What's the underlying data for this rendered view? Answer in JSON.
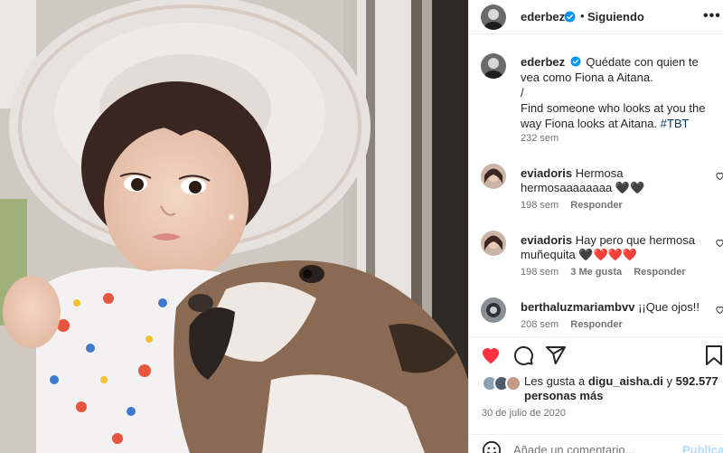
{
  "post": {
    "author": "ederbez",
    "follow_separator": "•",
    "follow_status": "Siguiendo",
    "more_label": "•••",
    "media_image": "little-girl-in-wide-sun-hat-with-bulldog",
    "caption": {
      "username": "ederbez",
      "line1": "Quédate con quien te vea como Fiona a Aitana.",
      "line2": "/",
      "line3": "Find someone who looks at you the way Fiona looks at Aitana.",
      "hashtag": "#TBT",
      "time": "232 sem"
    },
    "comments": [
      {
        "username": "eviadoris",
        "text": "Hermosa hermosaaaaaaaa",
        "emoji": "🖤🖤",
        "time": "198 sem",
        "likes": "",
        "reply": "Responder"
      },
      {
        "username": "eviadoris",
        "text": "Hay pero que hermosa muñequita",
        "emoji": "🖤❤️❤️❤️",
        "time": "198 sem",
        "likes": "3 Me gusta",
        "reply": "Responder"
      },
      {
        "username": "berthaluzmariambvv",
        "text": "¡¡Que ojos!!",
        "emoji": "",
        "time": "208 sem",
        "likes": "",
        "reply": "Responder"
      }
    ],
    "actions": {
      "like": "heart-filled-icon",
      "comment": "comment-icon",
      "share": "share-icon",
      "save": "bookmark-icon",
      "like_color": "#ff3040"
    },
    "likes": {
      "prefix": "Les gusta a",
      "user": "digu_aisha.di",
      "joiner": "y",
      "count": "592.577",
      "suffix": "personas más"
    },
    "date": "30 de julio de 2020",
    "add_comment": {
      "placeholder": "Añade un comentario...",
      "post_label": "Publicar"
    },
    "colors": {
      "verified": "#0095f6",
      "link": "#00376b",
      "muted": "#737373"
    }
  }
}
